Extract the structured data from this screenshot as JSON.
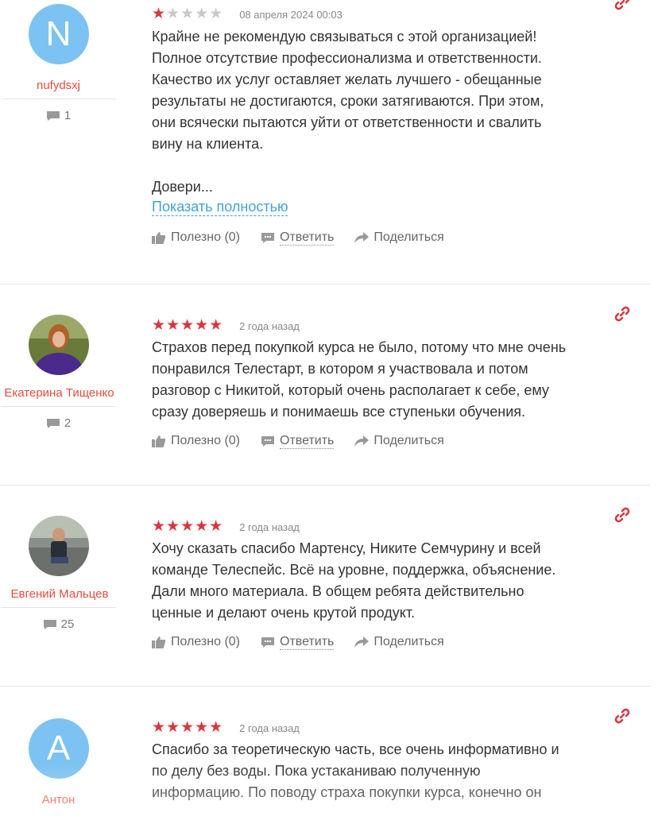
{
  "reviews": [
    {
      "user": {
        "initial": "N",
        "name": "nufydsxj",
        "count": "1"
      },
      "rating": 1,
      "date": "08 апреля 2024 00:03",
      "lines": [
        "Крайне не рекомендую связываться с этой организацией!",
        "Полное отсутствие профессионализма и ответственности.",
        "Качество их услуг оставляет желать лучшего - обещанные",
        "результаты не достигаются, сроки затягиваются. При этом,",
        "они всячески пытаются уйти от ответственности и свалить",
        "вину на клиента."
      ],
      "truncated": "Довери...",
      "show_more": "Показать полностью",
      "actions": {
        "useful": "Полезно (0)",
        "reply": "Ответить",
        "share": "Поделиться"
      }
    },
    {
      "user": {
        "name": "Екатерина Тищенко",
        "count": "2"
      },
      "rating": 5,
      "date": "2 года назад",
      "lines": [
        "Страхов перед покупкой курса не было, потому что мне очень",
        "понравился Телестарт, в котором я участвовала и потом",
        "разговор с Никитой, который очень располагает к себе, ему",
        "сразу доверяешь и понимаешь все ступеньки обучения."
      ],
      "actions": {
        "useful": "Полезно (0)",
        "reply": "Ответить",
        "share": "Поделиться"
      }
    },
    {
      "user": {
        "name": "Евгений Мальцев",
        "count": "25"
      },
      "rating": 5,
      "date": "2 года назад",
      "lines": [
        "Хочу сказать спасибо Мартенсу, Никите Семчурину и всей",
        "команде Телеспейс. Всё на уровне, поддержка, объяснение.",
        "Дали много материала. В общем ребята действительно",
        "ценные и делают очень крутой продукт."
      ],
      "actions": {
        "useful": "Полезно (0)",
        "reply": "Ответить",
        "share": "Поделиться"
      }
    },
    {
      "user": {
        "initial": "А",
        "name": "Антон"
      },
      "rating": 5,
      "date": "2 года назад",
      "lines": [
        "Спасибо за теоретическую часть, все очень информативно и",
        "по делу без воды. Пока устаканиваю полученную",
        "информацию. По поводу страха покупки курса, конечно он"
      ]
    }
  ],
  "colors": {
    "accent": "#d9363e",
    "link": "#3fa3d6",
    "avatar_bg": "#7cc2f2",
    "username": "#e74c3c"
  },
  "icons": {
    "like": "thumbs-up-icon",
    "reply": "speech-bubble-icon",
    "share": "share-arrow-icon",
    "permalink": "link-icon",
    "comments": "comment-count-icon"
  }
}
